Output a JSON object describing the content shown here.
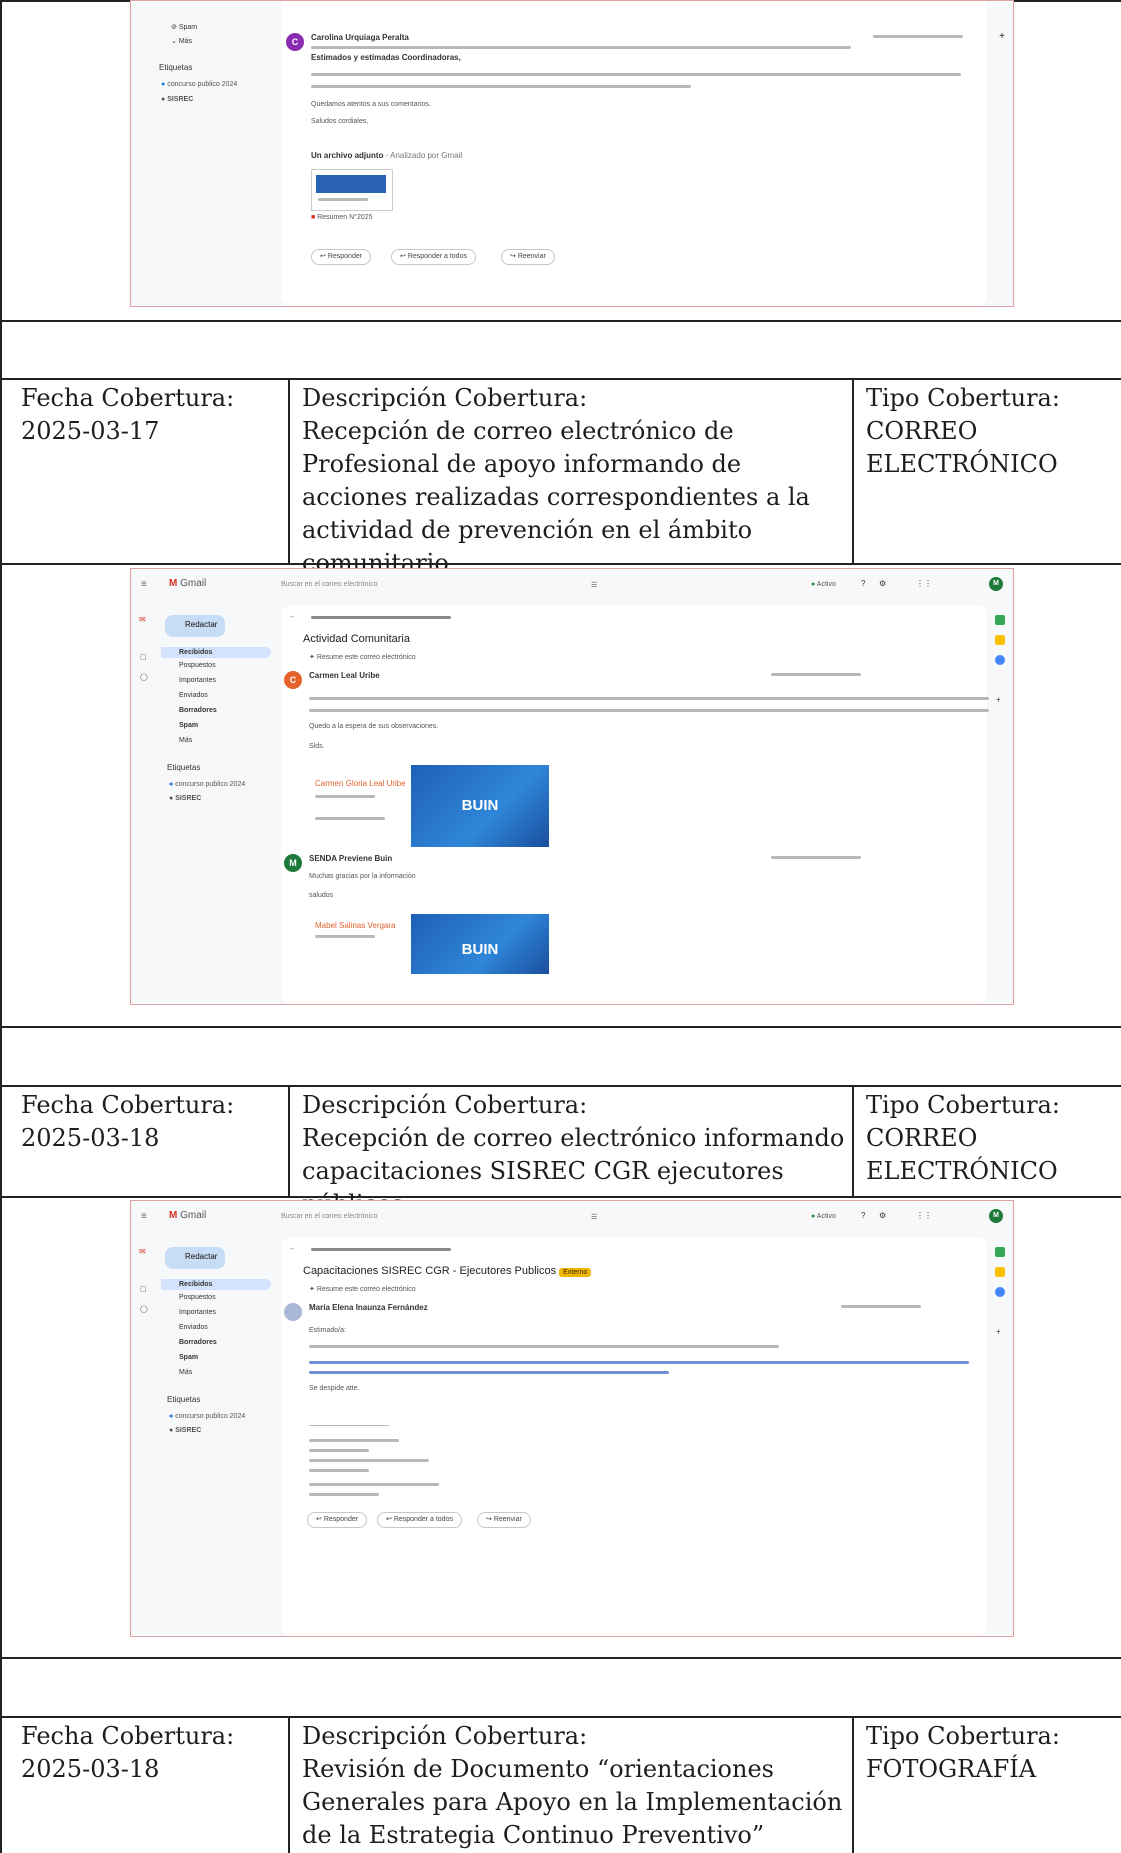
{
  "labels": {
    "fecha": "Fecha Cobertura:",
    "descripcion": "Descripción Cobertura:",
    "tipo": "Tipo Cobertura:"
  },
  "rows": [
    {
      "fecha": "2025-03-17",
      "descripcion": "Recepción de correo electrónico de Profesional de apoyo informando de acciones realizadas correspondientes a la actividad de prevención en el ámbito comunitario.",
      "tipo": "CORREO ELECTRÓNICO"
    },
    {
      "fecha": "2025-03-18",
      "descripcion": "Recepción de correo electrónico informando capacitaciones SISREC CGR ejecutores públicos",
      "tipo": "CORREO ELECTRÓNICO"
    },
    {
      "fecha": "2025-03-18",
      "descripcion": "Revisión de Documento “orientaciones Generales para Apoyo en la Implementación de la Estrategia Continuo Preventivo”",
      "tipo": "FOTOGRAFÍA"
    }
  ],
  "shot1": {
    "sender": "Carolina Urquiaga Peralta",
    "avatar": "C",
    "greeting": "Estimados y estimadas Coordinadoras,",
    "closing1": "Quedamos atentos a sus comentarios.",
    "closing2": "Saludos cordiales,",
    "attach_title": "Un archivo adjunto",
    "attach_scan": "Analizado por Gmail",
    "attach_file": "Resumen N°2025",
    "reply": "Responder",
    "reply_all": "Responder a todos",
    "forward": "Reenviar",
    "nav": [
      "Spam",
      "Más"
    ],
    "labels_title": "Etiquetas",
    "labels": [
      "concurso publico 2024",
      "SISREC"
    ]
  },
  "shot2": {
    "app": "Gmail",
    "search": "Buscar en el correo electrónico",
    "status": "Activo",
    "compose": "Redactar",
    "nav": [
      "Recibidos",
      "Pospuestos",
      "Importantes",
      "Enviados",
      "Borradores",
      "Spam",
      "Más"
    ],
    "labels_title": "Etiquetas",
    "labels": [
      "concurso publico 2024",
      "SISREC"
    ],
    "subject": "Actividad Comunitaria",
    "summary": "Resume este correo electrónico",
    "sender1": "Carmen Leal Uribe",
    "avatar1": "C",
    "closing1": "Quedo a la espera de sus observaciones.",
    "closing2": "Slds.",
    "sig1": "Carmen Gloria Leal Uribe",
    "sender2": "SENDA Previene Buin",
    "avatar2": "M",
    "body2": "Muchas gracias por la información",
    "closing3": "saludos",
    "sig2": "Mabel Salinas Vergara",
    "logo": "BUIN"
  },
  "shot3": {
    "app": "Gmail",
    "search": "Buscar en el correo electrónico",
    "status": "Activo",
    "compose": "Redactar",
    "nav": [
      "Recibidos",
      "Pospuestos",
      "Importantes",
      "Enviados",
      "Borradores",
      "Spam",
      "Más"
    ],
    "labels_title": "Etiquetas",
    "labels": [
      "concurso publico 2024",
      "SISREC"
    ],
    "subject": "Capacitaciones SISREC CGR - Ejecutores Publicos",
    "tag": "Externo",
    "summary": "Resume este correo electrónico",
    "sender": "María Elena Inaunza Fernández",
    "greeting": "Estimado/a:",
    "closing": "Se despide atte.",
    "reply": "Responder",
    "reply_all": "Responder a todos",
    "forward": "Reenviar"
  },
  "colors": {
    "border": "#222222",
    "frame": "#e3a0a0",
    "gmail_red": "#d93025",
    "compose_blue": "#c7dcf5",
    "buin_blue": "#1f5fb8"
  }
}
